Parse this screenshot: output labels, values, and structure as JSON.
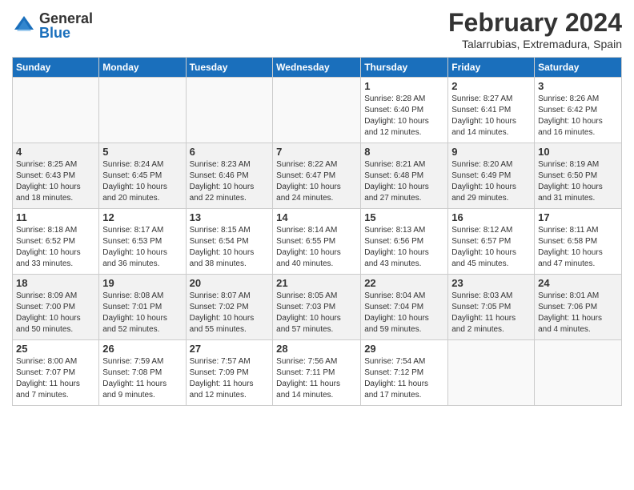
{
  "logo": {
    "general": "General",
    "blue": "Blue"
  },
  "header": {
    "month": "February 2024",
    "location": "Talarrubias, Extremadura, Spain"
  },
  "weekdays": [
    "Sunday",
    "Monday",
    "Tuesday",
    "Wednesday",
    "Thursday",
    "Friday",
    "Saturday"
  ],
  "weeks": [
    [
      {
        "day": "",
        "info": ""
      },
      {
        "day": "",
        "info": ""
      },
      {
        "day": "",
        "info": ""
      },
      {
        "day": "",
        "info": ""
      },
      {
        "day": "1",
        "info": "Sunrise: 8:28 AM\nSunset: 6:40 PM\nDaylight: 10 hours\nand 12 minutes."
      },
      {
        "day": "2",
        "info": "Sunrise: 8:27 AM\nSunset: 6:41 PM\nDaylight: 10 hours\nand 14 minutes."
      },
      {
        "day": "3",
        "info": "Sunrise: 8:26 AM\nSunset: 6:42 PM\nDaylight: 10 hours\nand 16 minutes."
      }
    ],
    [
      {
        "day": "4",
        "info": "Sunrise: 8:25 AM\nSunset: 6:43 PM\nDaylight: 10 hours\nand 18 minutes."
      },
      {
        "day": "5",
        "info": "Sunrise: 8:24 AM\nSunset: 6:45 PM\nDaylight: 10 hours\nand 20 minutes."
      },
      {
        "day": "6",
        "info": "Sunrise: 8:23 AM\nSunset: 6:46 PM\nDaylight: 10 hours\nand 22 minutes."
      },
      {
        "day": "7",
        "info": "Sunrise: 8:22 AM\nSunset: 6:47 PM\nDaylight: 10 hours\nand 24 minutes."
      },
      {
        "day": "8",
        "info": "Sunrise: 8:21 AM\nSunset: 6:48 PM\nDaylight: 10 hours\nand 27 minutes."
      },
      {
        "day": "9",
        "info": "Sunrise: 8:20 AM\nSunset: 6:49 PM\nDaylight: 10 hours\nand 29 minutes."
      },
      {
        "day": "10",
        "info": "Sunrise: 8:19 AM\nSunset: 6:50 PM\nDaylight: 10 hours\nand 31 minutes."
      }
    ],
    [
      {
        "day": "11",
        "info": "Sunrise: 8:18 AM\nSunset: 6:52 PM\nDaylight: 10 hours\nand 33 minutes."
      },
      {
        "day": "12",
        "info": "Sunrise: 8:17 AM\nSunset: 6:53 PM\nDaylight: 10 hours\nand 36 minutes."
      },
      {
        "day": "13",
        "info": "Sunrise: 8:15 AM\nSunset: 6:54 PM\nDaylight: 10 hours\nand 38 minutes."
      },
      {
        "day": "14",
        "info": "Sunrise: 8:14 AM\nSunset: 6:55 PM\nDaylight: 10 hours\nand 40 minutes."
      },
      {
        "day": "15",
        "info": "Sunrise: 8:13 AM\nSunset: 6:56 PM\nDaylight: 10 hours\nand 43 minutes."
      },
      {
        "day": "16",
        "info": "Sunrise: 8:12 AM\nSunset: 6:57 PM\nDaylight: 10 hours\nand 45 minutes."
      },
      {
        "day": "17",
        "info": "Sunrise: 8:11 AM\nSunset: 6:58 PM\nDaylight: 10 hours\nand 47 minutes."
      }
    ],
    [
      {
        "day": "18",
        "info": "Sunrise: 8:09 AM\nSunset: 7:00 PM\nDaylight: 10 hours\nand 50 minutes."
      },
      {
        "day": "19",
        "info": "Sunrise: 8:08 AM\nSunset: 7:01 PM\nDaylight: 10 hours\nand 52 minutes."
      },
      {
        "day": "20",
        "info": "Sunrise: 8:07 AM\nSunset: 7:02 PM\nDaylight: 10 hours\nand 55 minutes."
      },
      {
        "day": "21",
        "info": "Sunrise: 8:05 AM\nSunset: 7:03 PM\nDaylight: 10 hours\nand 57 minutes."
      },
      {
        "day": "22",
        "info": "Sunrise: 8:04 AM\nSunset: 7:04 PM\nDaylight: 10 hours\nand 59 minutes."
      },
      {
        "day": "23",
        "info": "Sunrise: 8:03 AM\nSunset: 7:05 PM\nDaylight: 11 hours\nand 2 minutes."
      },
      {
        "day": "24",
        "info": "Sunrise: 8:01 AM\nSunset: 7:06 PM\nDaylight: 11 hours\nand 4 minutes."
      }
    ],
    [
      {
        "day": "25",
        "info": "Sunrise: 8:00 AM\nSunset: 7:07 PM\nDaylight: 11 hours\nand 7 minutes."
      },
      {
        "day": "26",
        "info": "Sunrise: 7:59 AM\nSunset: 7:08 PM\nDaylight: 11 hours\nand 9 minutes."
      },
      {
        "day": "27",
        "info": "Sunrise: 7:57 AM\nSunset: 7:09 PM\nDaylight: 11 hours\nand 12 minutes."
      },
      {
        "day": "28",
        "info": "Sunrise: 7:56 AM\nSunset: 7:11 PM\nDaylight: 11 hours\nand 14 minutes."
      },
      {
        "day": "29",
        "info": "Sunrise: 7:54 AM\nSunset: 7:12 PM\nDaylight: 11 hours\nand 17 minutes."
      },
      {
        "day": "",
        "info": ""
      },
      {
        "day": "",
        "info": ""
      }
    ]
  ]
}
